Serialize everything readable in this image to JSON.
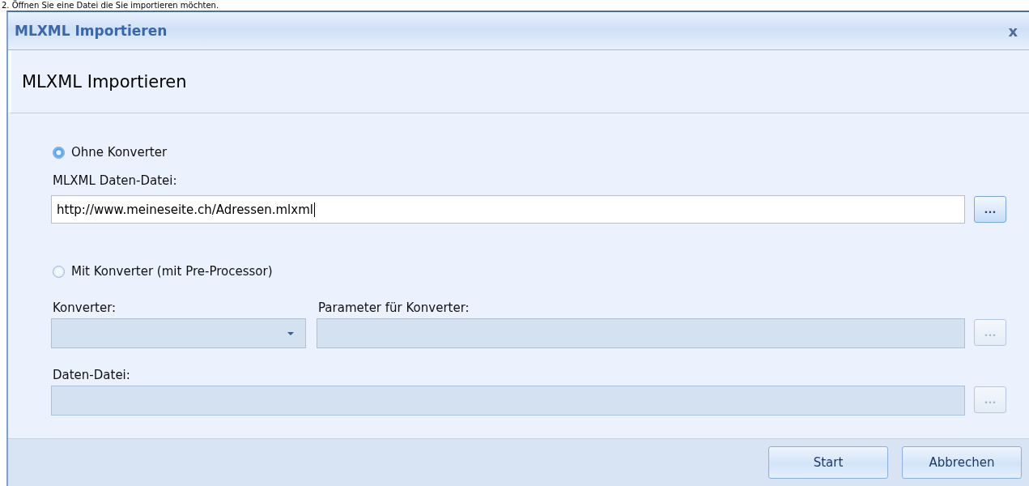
{
  "caption": "2. Öffnen Sie eine Datei die Sie importieren möchten.",
  "window": {
    "title": "MLXML Importieren",
    "close": "x"
  },
  "header": "MLXML Importieren",
  "options": [
    {
      "label": "Ohne Konverter",
      "selected": true
    },
    {
      "label": "Mit Konverter (mit Pre-Processor)",
      "selected": false
    }
  ],
  "source_file": {
    "label": "MLXML Daten-Datei:",
    "value": "http://www.meineseite.ch/Adressen.mlxml",
    "disabled": false,
    "browse": "..."
  },
  "converter": {
    "label": "Konverter:",
    "disabled": true
  },
  "parameter": {
    "label": "Parameter für Konverter:",
    "disabled": true,
    "browse": "..."
  },
  "data_file": {
    "label": "Daten-Datei:",
    "disabled": true,
    "browse": "..."
  },
  "buttons": [
    "Start",
    "Abbrechen"
  ]
}
